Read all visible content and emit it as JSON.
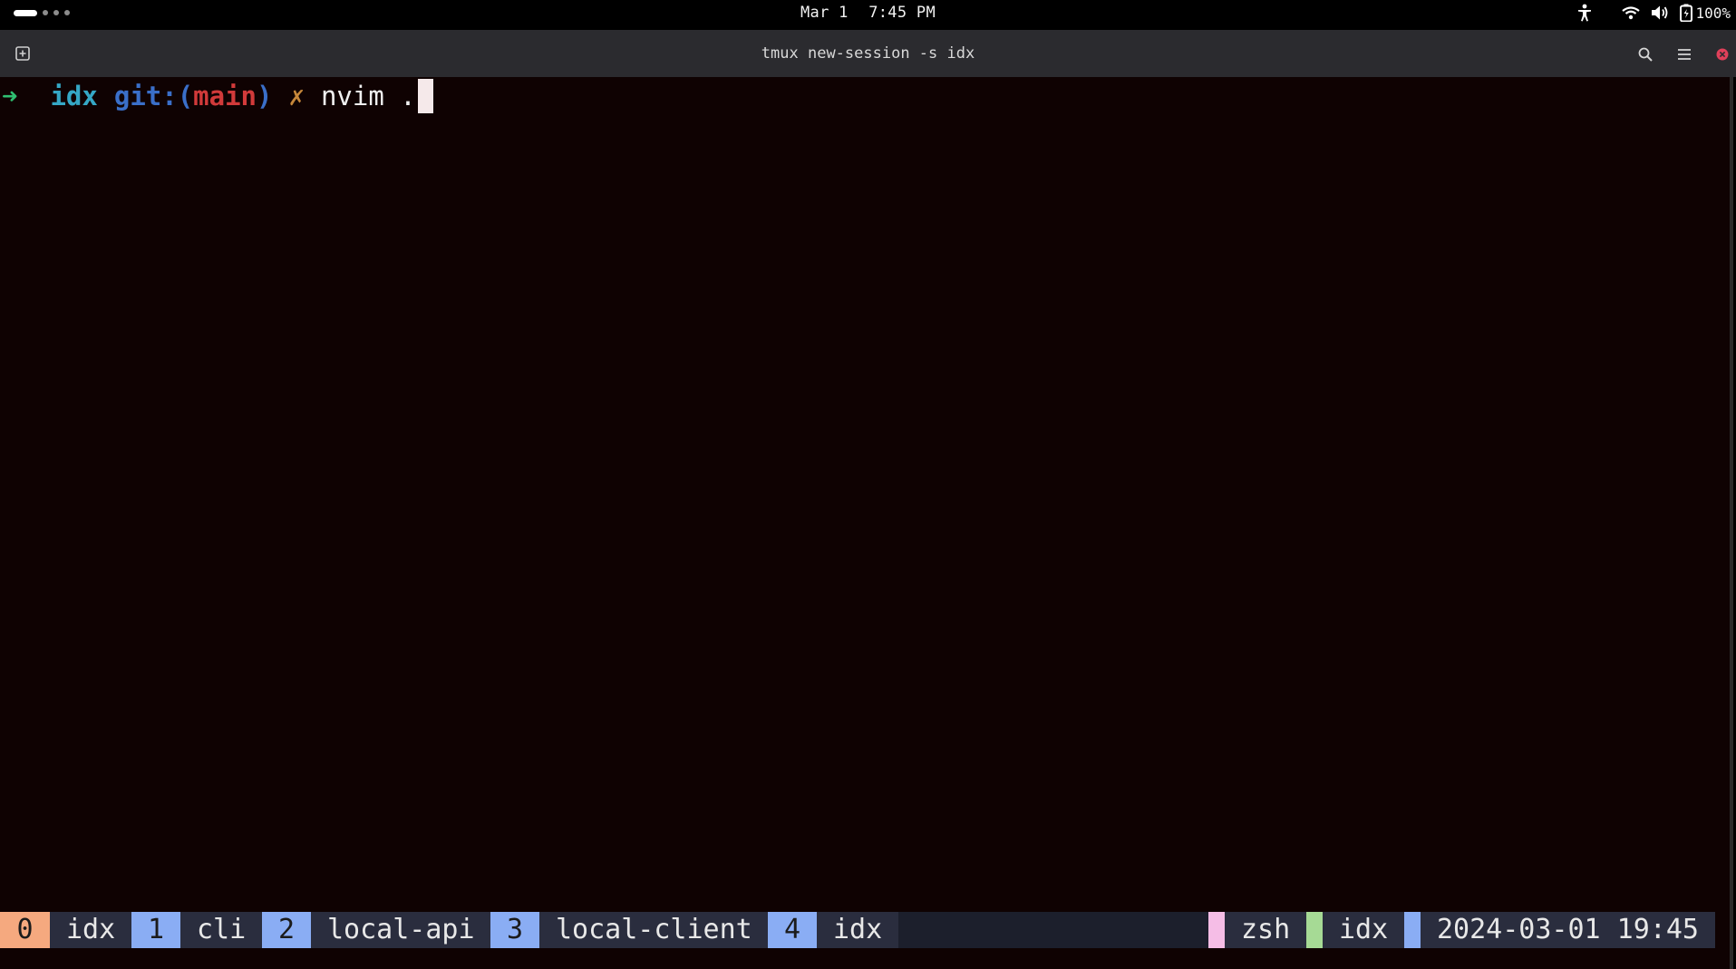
{
  "system_bar": {
    "date": "Mar 1",
    "time": "7:45 PM",
    "battery": "100%"
  },
  "window": {
    "title": "tmux new-session -s idx"
  },
  "terminal": {
    "prompt_symbol": "➜",
    "directory": "idx",
    "git_label": "git:",
    "paren_open": "(",
    "branch": "main",
    "paren_close": ")",
    "dirty_marker": "✗",
    "command": "nvim ."
  },
  "tmux": {
    "windows": [
      {
        "index": "0",
        "name": "idx",
        "active": true
      },
      {
        "index": "1",
        "name": "cli",
        "active": false
      },
      {
        "index": "2",
        "name": "local-api",
        "active": false
      },
      {
        "index": "3",
        "name": "local-client",
        "active": false
      },
      {
        "index": "4",
        "name": "idx",
        "active": false
      }
    ],
    "status_right": {
      "program": "zsh",
      "session": "idx",
      "datetime": "2024-03-01 19:45"
    }
  },
  "colors": {
    "active_window": "#f5a97f",
    "inactive_window": "#8aadf4",
    "program_accent": "#f5bde6",
    "session_accent": "#a6da95",
    "datetime_accent": "#8aadf4"
  }
}
